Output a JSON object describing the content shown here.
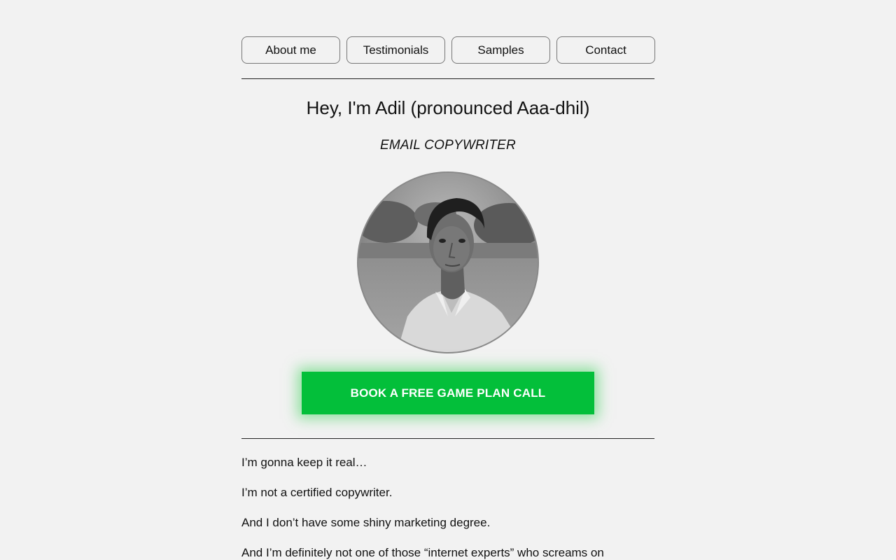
{
  "nav": {
    "items": [
      {
        "label": "About me"
      },
      {
        "label": "Testimonials"
      },
      {
        "label": "Samples"
      },
      {
        "label": "Contact"
      }
    ]
  },
  "hero": {
    "title": "Hey, I'm Adil (pronounced Aaa-dhil)",
    "subtitle": "EMAIL COPYWRITER",
    "photo_alt": "Adil portrait"
  },
  "cta": {
    "label": "BOOK A FREE GAME PLAN CALL",
    "color": "#03bf3a"
  },
  "intro": {
    "paragraphs": [
      "I’m gonna keep it real…",
      "I’m not a certified copywriter.",
      "And I don’t have some shiny marketing degree.",
      "And I’m definitely not one of those “internet experts” who screams on"
    ]
  }
}
